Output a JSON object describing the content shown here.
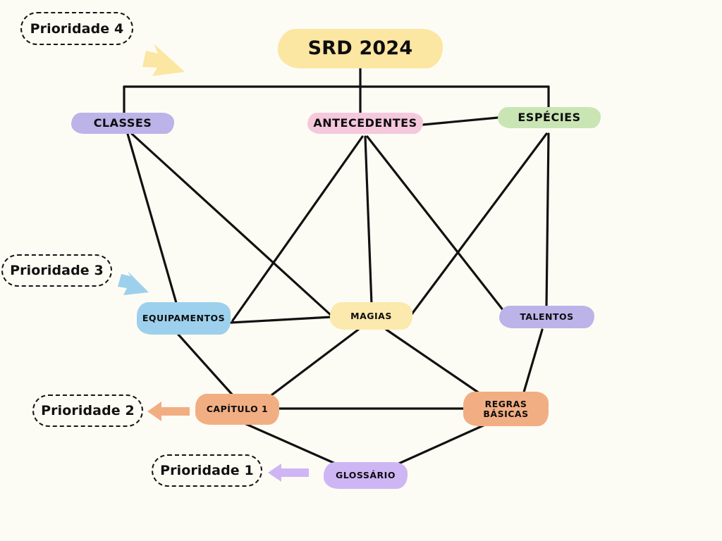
{
  "diagram": {
    "title": "SRD 2024",
    "background_color": "#fdfcf4",
    "edge_color": "#111111",
    "root": {
      "id": "srd",
      "label": "SRD 2024",
      "color": "#fbe6a2"
    },
    "nodes": [
      {
        "id": "classes",
        "label": "CLASSES",
        "color": "#bcb3e8"
      },
      {
        "id": "antecedentes",
        "label": "ANTECEDENTES",
        "color": "#f6c8dc"
      },
      {
        "id": "especies",
        "label": "ESPÉCIES",
        "color": "#c9e5b4"
      },
      {
        "id": "equipamentos",
        "label": "EQUIPAMENTOS",
        "color": "#9dd0ec"
      },
      {
        "id": "magias",
        "label": "MAGIAS",
        "color": "#fbe9ad"
      },
      {
        "id": "talentos",
        "label": "TALENTOS",
        "color": "#bcb3e8"
      },
      {
        "id": "capitulo1",
        "label": "CAPÍTULO 1",
        "color": "#f2ae83"
      },
      {
        "id": "regras",
        "label": "REGRAS\nBÁSICAS",
        "label_line1": "REGRAS",
        "label_line2": "BÁSICAS",
        "color": "#f2ae83"
      },
      {
        "id": "glossario",
        "label": "GLOSSÁRIO",
        "color": "#ceb6f5"
      }
    ],
    "priorities": [
      {
        "id": "p4",
        "label": "Prioridade 4",
        "arrow_color": "#fbe6a2",
        "points_to": "classes"
      },
      {
        "id": "p3",
        "label": "Prioridade 3",
        "arrow_color": "#9dd0ec",
        "points_to": "equipamentos"
      },
      {
        "id": "p2",
        "label": "Prioridade 2",
        "arrow_color": "#f2ae83",
        "points_to": "capitulo1"
      },
      {
        "id": "p1",
        "label": "Prioridade 1",
        "arrow_color": "#ceb6f5",
        "points_to": "glossario"
      }
    ],
    "edges": [
      {
        "from": "srd",
        "to": "classes"
      },
      {
        "from": "srd",
        "to": "antecedentes"
      },
      {
        "from": "srd",
        "to": "especies"
      },
      {
        "from": "antecedentes",
        "to": "especies"
      },
      {
        "from": "classes",
        "to": "equipamentos"
      },
      {
        "from": "classes",
        "to": "magias"
      },
      {
        "from": "antecedentes",
        "to": "equipamentos"
      },
      {
        "from": "antecedentes",
        "to": "magias"
      },
      {
        "from": "antecedentes",
        "to": "talentos"
      },
      {
        "from": "especies",
        "to": "magias"
      },
      {
        "from": "especies",
        "to": "talentos"
      },
      {
        "from": "equipamentos",
        "to": "magias"
      },
      {
        "from": "equipamentos",
        "to": "capitulo1"
      },
      {
        "from": "magias",
        "to": "capitulo1"
      },
      {
        "from": "magias",
        "to": "regras"
      },
      {
        "from": "talentos",
        "to": "regras"
      },
      {
        "from": "capitulo1",
        "to": "regras"
      },
      {
        "from": "capitulo1",
        "to": "glossario"
      },
      {
        "from": "regras",
        "to": "glossario"
      }
    ]
  }
}
